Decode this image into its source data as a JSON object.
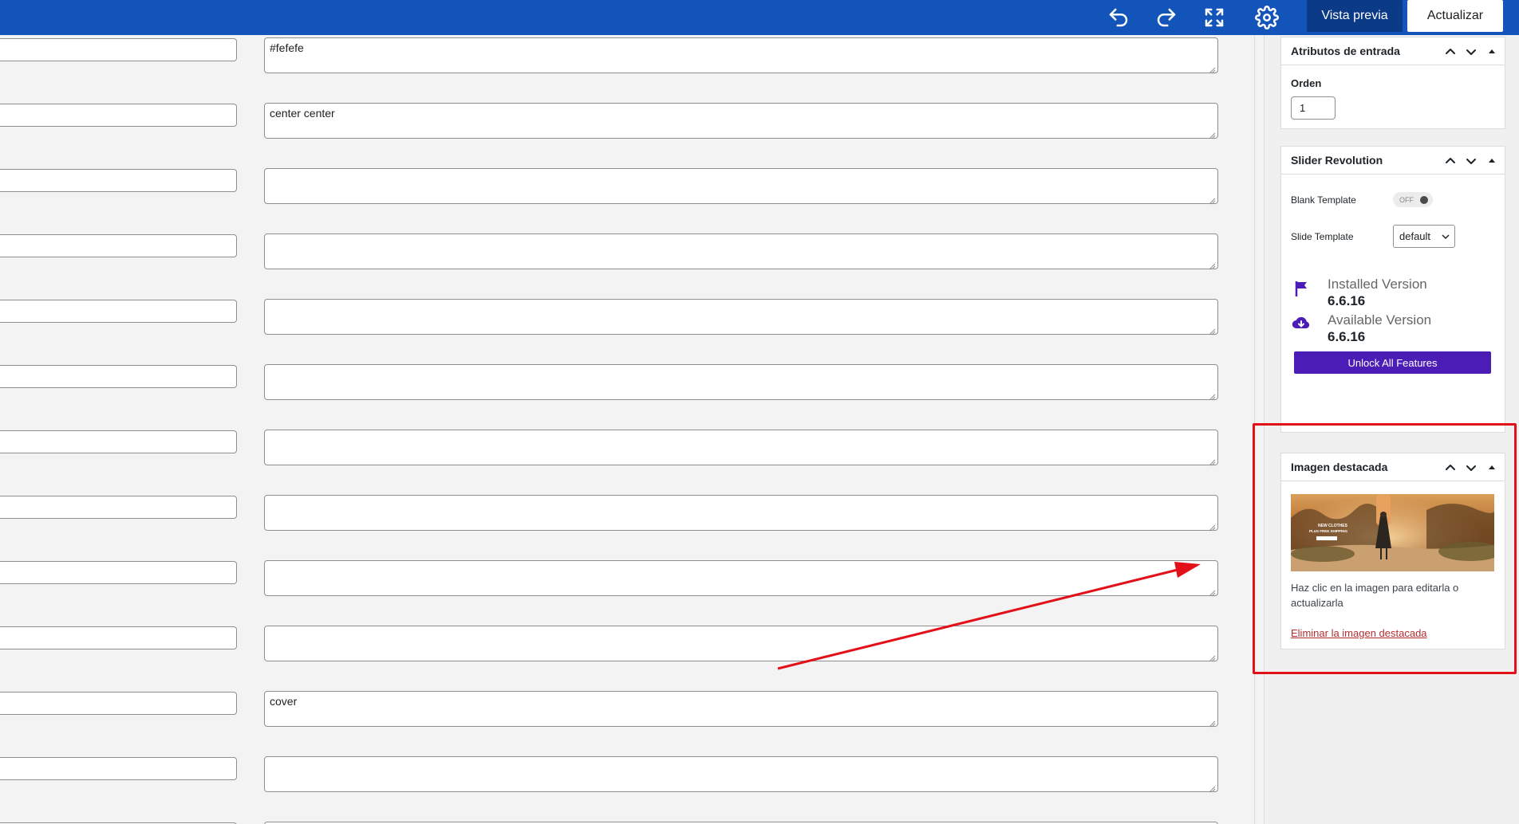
{
  "toolbar": {
    "undo_icon": "undo-icon",
    "redo_icon": "redo-icon",
    "fullscreen_icon": "fullscreen-icon",
    "settings_icon": "gear-icon",
    "preview_label": "Vista previa",
    "update_label": "Actualizar"
  },
  "fields": {
    "rows": [
      {
        "right_value": "#fefefe"
      },
      {
        "right_value": "center center"
      },
      {
        "right_value": ""
      },
      {
        "right_value": ""
      },
      {
        "right_value": ""
      },
      {
        "right_value": ""
      },
      {
        "right_value": ""
      },
      {
        "right_value": ""
      },
      {
        "right_value": ""
      },
      {
        "right_value": ""
      },
      {
        "right_value": "cover"
      },
      {
        "right_value": ""
      },
      {
        "right_value": ""
      }
    ]
  },
  "sidebar": {
    "page_attributes": {
      "title": "Atributos de entrada",
      "order_label": "Orden",
      "order_value": "1"
    },
    "slider_revolution": {
      "title": "Slider Revolution",
      "blank_template_label": "Blank Template",
      "toggle_text": "OFF",
      "slide_template_label": "Slide Template",
      "slide_template_value": "default",
      "installed_label": "Installed Version",
      "installed_value": "6.6.16",
      "available_label": "Available Version",
      "available_value": "6.6.16",
      "unlock_label": "Unlock All Features",
      "accent": "#4c1db6"
    },
    "featured_image": {
      "title": "Imagen destacada",
      "image_text_line1": "NEW CLOTHES",
      "image_text_line2": "PLUS FREE SHIPPING",
      "caption": "Haz clic en la imagen para editarla o actualizarla",
      "remove_link": "Eliminar la imagen destacada"
    }
  },
  "colors": {
    "topbar": "#1254b9",
    "annotation": "#e3101a"
  }
}
